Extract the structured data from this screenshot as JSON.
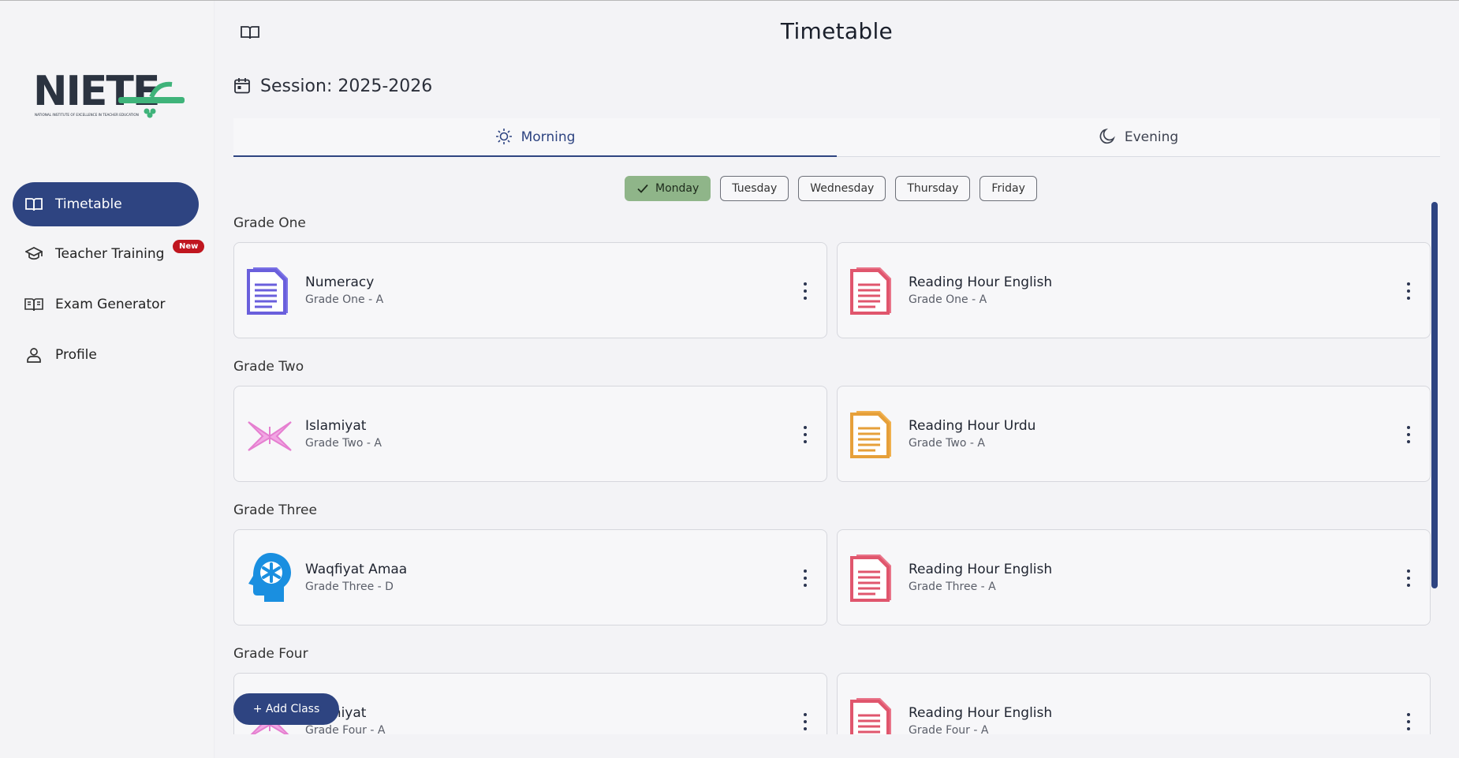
{
  "brand": {
    "logo_text": "NIETE",
    "logo_subtext": "NATIONAL INSTITUTE OF EXCELLENCE IN TEACHER EDUCATION"
  },
  "sidebar": {
    "items": [
      {
        "label": "Timetable",
        "icon": "book-open-icon",
        "active": true
      },
      {
        "label": "Teacher Training",
        "icon": "graduation-cap-icon",
        "badge": "New"
      },
      {
        "label": "Exam Generator",
        "icon": "book-icon"
      },
      {
        "label": "Profile",
        "icon": "user-icon"
      }
    ]
  },
  "header": {
    "title": "Timetable",
    "menu_icon": "book-open-icon"
  },
  "session": {
    "label": "Session: 2025-2026",
    "icon": "calendar-icon"
  },
  "shifts": [
    {
      "label": "Morning",
      "icon": "sun-icon",
      "active": true
    },
    {
      "label": "Evening",
      "icon": "moon-icon"
    }
  ],
  "days": [
    {
      "label": "Monday",
      "active": true
    },
    {
      "label": "Tuesday"
    },
    {
      "label": "Wednesday"
    },
    {
      "label": "Thursday"
    },
    {
      "label": "Friday"
    }
  ],
  "grades": [
    {
      "name": "Grade One",
      "classes": [
        {
          "subject": "Numeracy",
          "section": "Grade One - A",
          "icon": "document-purple-icon"
        },
        {
          "subject": "Reading Hour English",
          "section": "Grade One - A",
          "icon": "document-red-icon"
        }
      ]
    },
    {
      "name": "Grade Two",
      "classes": [
        {
          "subject": "Islamiyat",
          "section": "Grade Two - A",
          "icon": "quran-book-icon"
        },
        {
          "subject": "Reading Hour Urdu",
          "section": "Grade Two - A",
          "icon": "document-orange-icon"
        }
      ]
    },
    {
      "name": "Grade Three",
      "classes": [
        {
          "subject": "Waqfiyat Amaa",
          "section": "Grade Three - D",
          "icon": "mind-head-icon"
        },
        {
          "subject": "Reading Hour English",
          "section": "Grade Three - A",
          "icon": "document-red-icon"
        }
      ]
    },
    {
      "name": "Grade Four",
      "classes": [
        {
          "subject": "Islamiyat",
          "section": "Grade Four - A",
          "icon": "quran-book-icon"
        },
        {
          "subject": "Reading Hour English",
          "section": "Grade Four - A",
          "icon": "document-red-icon"
        }
      ]
    }
  ],
  "actions": {
    "add_class": "+ Add Class"
  },
  "colors": {
    "primary": "#2e4481",
    "day_active": "#8fb589",
    "badge": "#c0161f",
    "doc_purple": "#6a5fdc",
    "doc_red": "#e0566d",
    "doc_orange": "#e6a03a",
    "quran_pink": "#e57fd0",
    "mind_blue": "#1a8fe0"
  }
}
